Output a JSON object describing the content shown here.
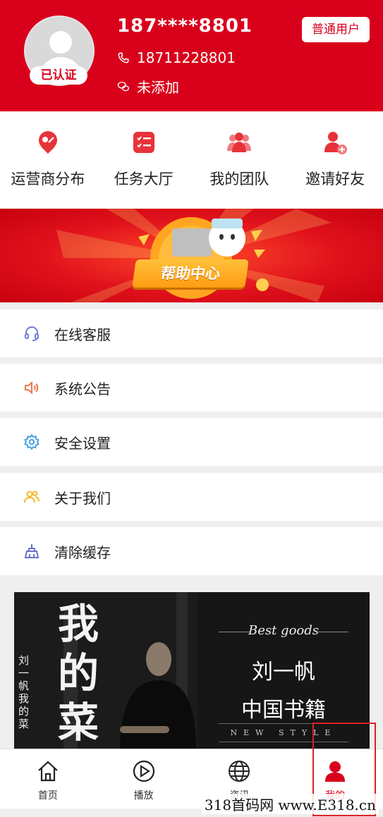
{
  "profile": {
    "masked_phone": "187****8801",
    "phone": "18711228801",
    "wechat": "未添加",
    "verified_badge": "已认证",
    "user_type": "普通用户"
  },
  "quick_actions": [
    {
      "label": "运营商分布",
      "icon": "location-pin-icon"
    },
    {
      "label": "任务大厅",
      "icon": "task-list-icon"
    },
    {
      "label": "我的团队",
      "icon": "team-icon"
    },
    {
      "label": "邀请好友",
      "icon": "add-user-icon"
    }
  ],
  "banner": {
    "button_label": "帮助中心"
  },
  "menu": [
    {
      "label": "在线客服",
      "icon": "headset-icon"
    },
    {
      "label": "系统公告",
      "icon": "speaker-icon"
    },
    {
      "label": "安全设置",
      "icon": "gear-icon"
    },
    {
      "label": "关于我们",
      "icon": "people-icon"
    },
    {
      "label": "清除缓存",
      "icon": "broom-icon"
    }
  ],
  "ad": {
    "left_calligraphy": "我的菜",
    "side_calligraphy": "刘一帆 我的菜",
    "best_goods": "Best goods",
    "name": "刘一帆",
    "book": "中国书籍",
    "style": "NEW STYLE"
  },
  "tabbar": [
    {
      "label": "首页",
      "icon": "home-icon"
    },
    {
      "label": "播放",
      "icon": "play-icon"
    },
    {
      "label": "资讯",
      "icon": "globe-icon"
    },
    {
      "label": "我的",
      "icon": "user-icon"
    }
  ],
  "watermark": "318首码网 www.E318.cn",
  "colors": {
    "brand_red": "#d9001b",
    "icon_red": "#e8323a",
    "banner_orange": "#ffa51f"
  }
}
